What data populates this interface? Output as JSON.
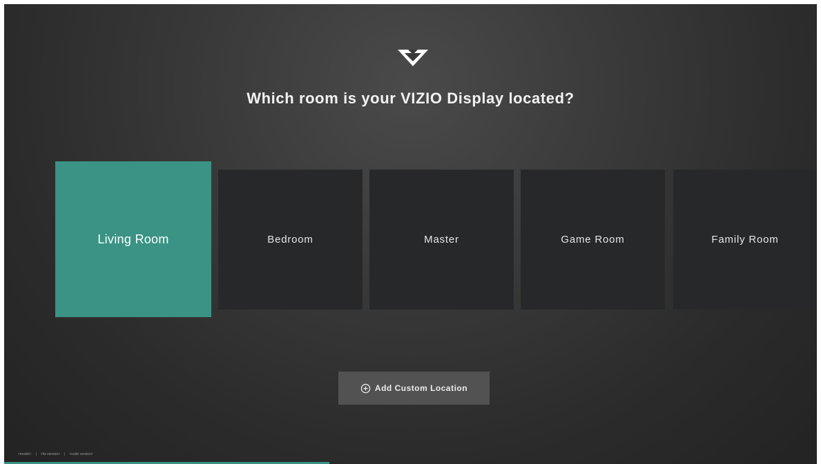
{
  "header": {
    "logo_icon": "vizio-v-logo-icon",
    "title": "Which room is your VIZIO Display located?"
  },
  "rooms": [
    {
      "label": "Living Room",
      "selected": true
    },
    {
      "label": "Bedroom",
      "selected": false
    },
    {
      "label": "Master",
      "selected": false
    },
    {
      "label": "Game Room",
      "selected": false
    },
    {
      "label": "Family Room",
      "selected": false
    }
  ],
  "add_button": {
    "icon": "plus-circle-icon",
    "label": "Add Custom Location"
  },
  "footer": {
    "model": "<model>",
    "fw_version": "<fw version>",
    "code_version": "<code version>",
    "separator": "|"
  },
  "progress": {
    "fraction": 0.4
  },
  "colors": {
    "accent": "#3a9384",
    "tile": "#27282a",
    "button": "#525253"
  }
}
